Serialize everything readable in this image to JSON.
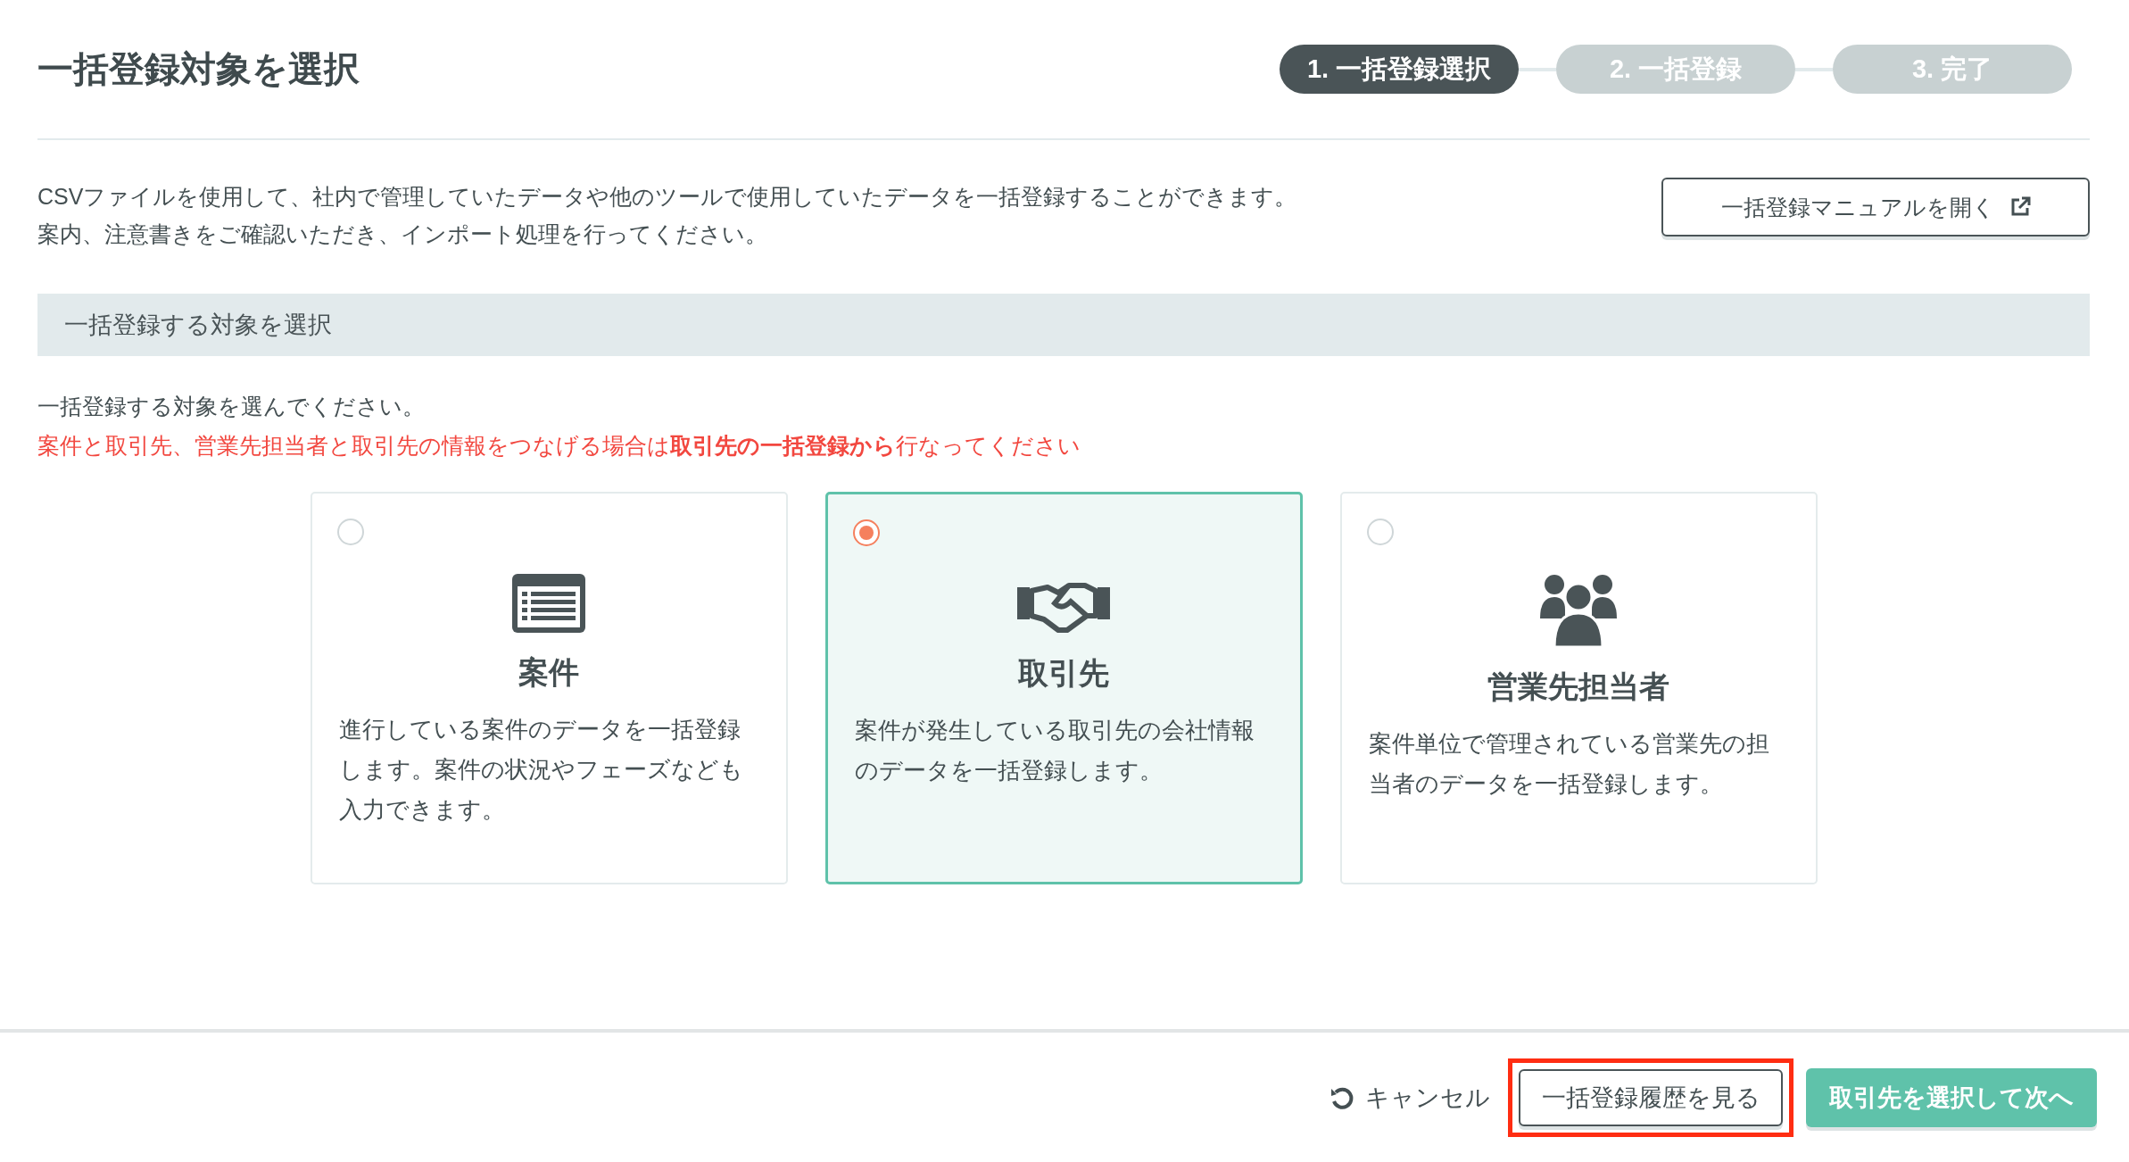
{
  "header": {
    "title": "一括登録対象を選択"
  },
  "steps": [
    {
      "label": "1. 一括登録選択",
      "selected": true
    },
    {
      "label": "2. 一括登録",
      "selected": false
    },
    {
      "label": "3. 完了",
      "selected": false
    }
  ],
  "intro": {
    "lines": [
      "CSVファイルを使用して、社内で管理していたデータや他のツールで使用していたデータを一括登録することができます。",
      "案内、注意書きをご確認いただき、インポート処理を行ってください。"
    ],
    "manual_button": "一括登録マニュアルを開く"
  },
  "section": {
    "heading": "一括登録する対象を選択",
    "instruction": "一括登録する対象を選んでください。",
    "warning": "案件と取引先、営業先担当者と取引先の情報をつなげる場合は**取引先の一括登録から**行なってください"
  },
  "options": [
    {
      "kind": "list",
      "title": "案件",
      "description": "進行している案件のデータを一括登録します。案件の状況やフェーズなども入力できます。",
      "selected": false
    },
    {
      "kind": "handshake",
      "title": "取引先",
      "description": "案件が発生している取引先の会社情報のデータを一括登録します。",
      "selected": true
    },
    {
      "kind": "people",
      "title": "営業先担当者",
      "description": "案件単位で管理されている営業先の担当者のデータを一括登録します。",
      "selected": false
    }
  ],
  "footer": {
    "cancel": "キャンセル",
    "history_button": {
      "label": "一括登録履歴を見る",
      "highlighted": true
    },
    "next_button": "取引先を選択して次へ"
  }
}
